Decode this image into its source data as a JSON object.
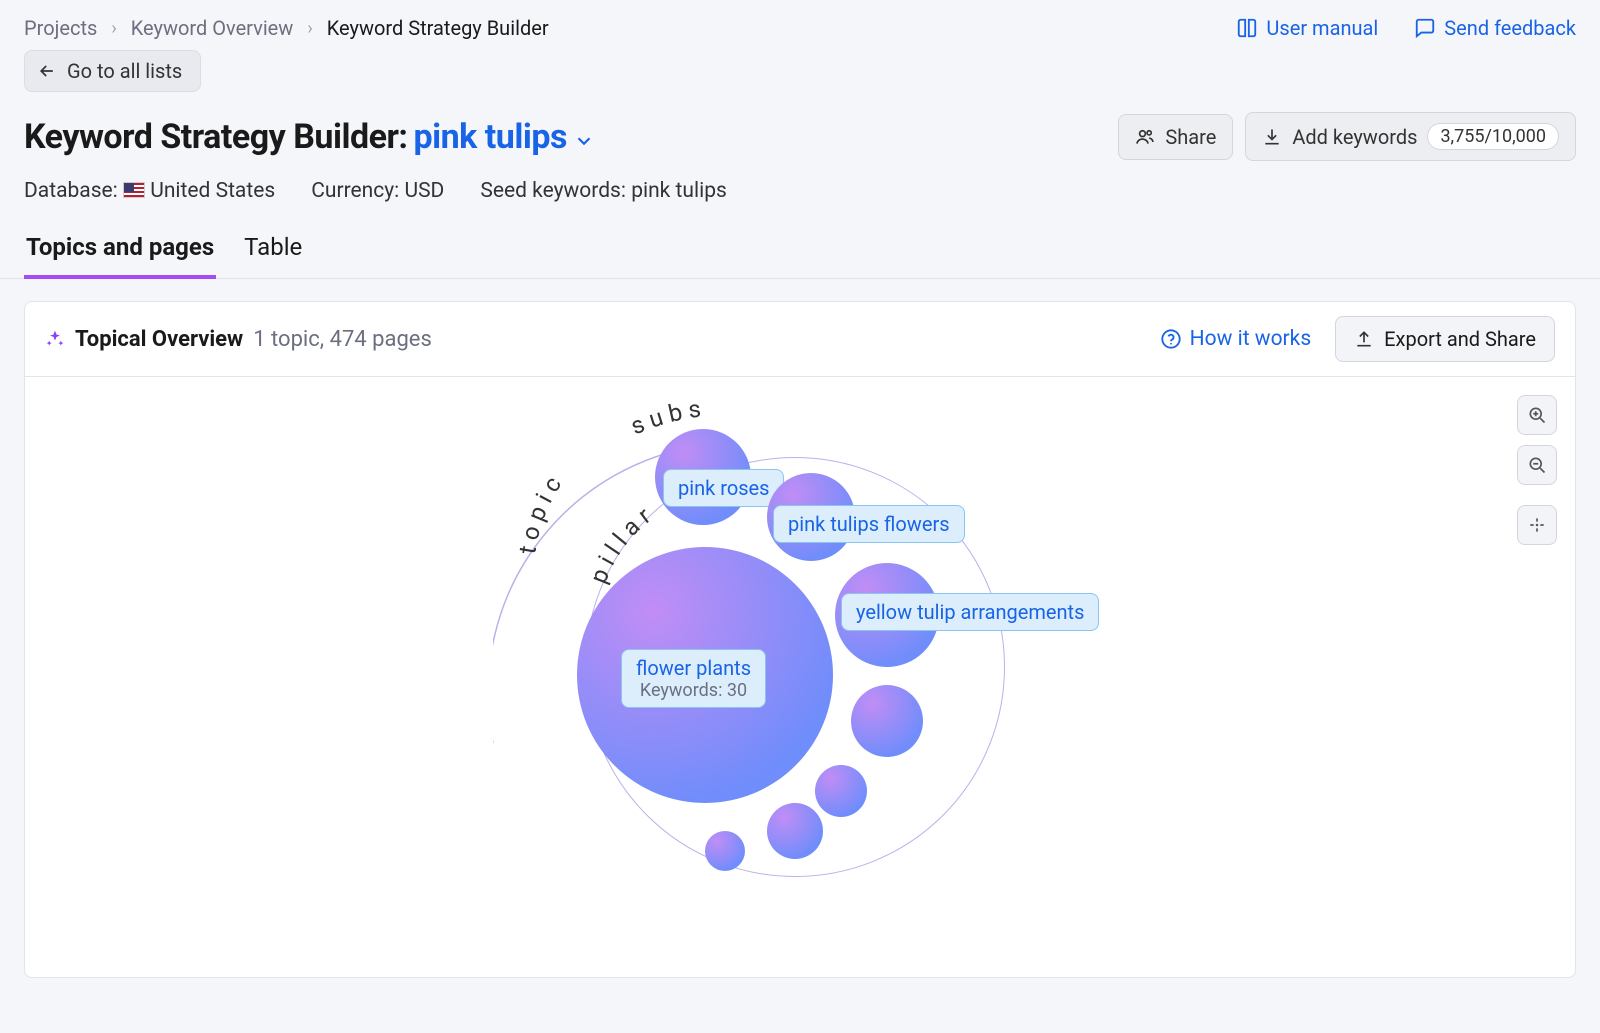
{
  "breadcrumbs": {
    "a": "Projects",
    "b": "Keyword Overview",
    "c": "Keyword Strategy Builder"
  },
  "top_links": {
    "manual": "User manual",
    "feedback": "Send feedback"
  },
  "back_button": "Go to all lists",
  "title": {
    "prefix": "Keyword Strategy Builder:",
    "seed": "pink tulips"
  },
  "actions": {
    "share": "Share",
    "add_keywords": "Add keywords",
    "add_keywords_count": "3,755/10,000"
  },
  "meta": {
    "database_label": "Database:",
    "database_value": "United States",
    "currency_label": "Currency:",
    "currency_value": "USD",
    "seed_label": "Seed keywords:",
    "seed_value": "pink tulips"
  },
  "tabs": {
    "topics": "Topics and pages",
    "table": "Table"
  },
  "panel": {
    "title": "Topical Overview",
    "subtitle": "1 topic, 474 pages",
    "how_link": "How it works",
    "export": "Export and Share"
  },
  "viz": {
    "arc_topic": "topic",
    "arc_pillar": "pillar",
    "arc_subs": "subs",
    "pillar": {
      "label": "flower plants",
      "sub": "Keywords: 30"
    },
    "subs": {
      "roses": "pink roses",
      "tulips_flowers": "pink tulips flowers",
      "yellow": "yellow tulip arrangements"
    }
  },
  "chart_data": {
    "type": "bubble",
    "title": "Topical Overview",
    "pillar": {
      "label": "flower plants",
      "keywords": 30
    },
    "sub_bubbles": [
      {
        "label": "pink roses",
        "approx_r": 48
      },
      {
        "label": "pink tulips flowers",
        "approx_r": 44
      },
      {
        "label": "yellow tulip arrangements",
        "approx_r": 52
      },
      {
        "label": null,
        "approx_r": 36
      },
      {
        "label": null,
        "approx_r": 26
      },
      {
        "label": null,
        "approx_r": 28
      },
      {
        "label": null,
        "approx_r": 20
      }
    ],
    "arcs": [
      "topic",
      "pillar",
      "subs"
    ]
  }
}
